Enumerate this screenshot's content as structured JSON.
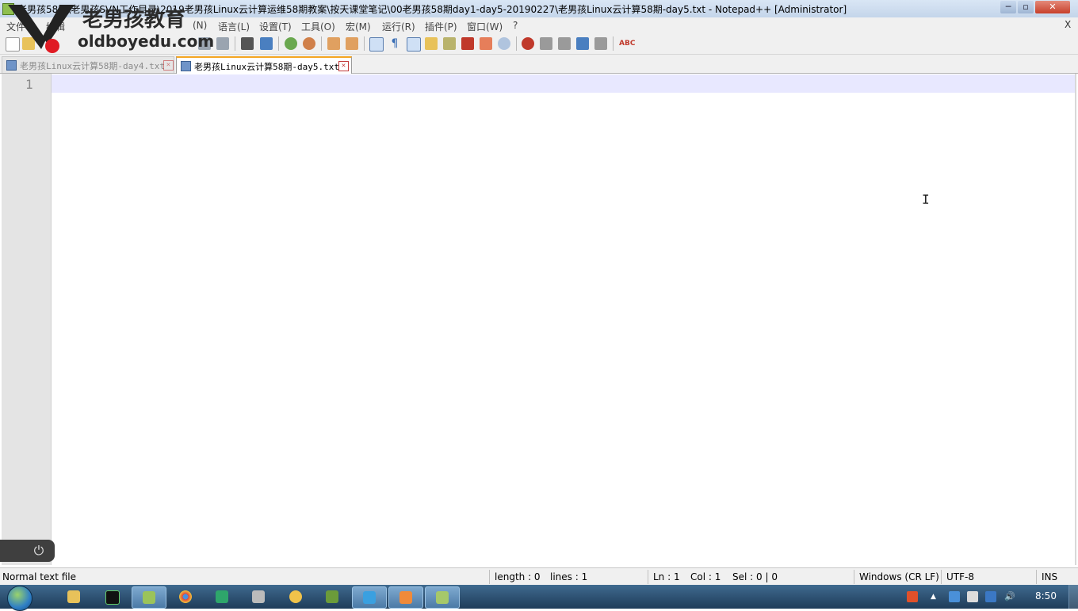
{
  "window": {
    "title": "老男孩58期\\老男孩SVN工作目录\\2019老男孩Linux云计算运维58期教案\\按天课堂笔记\\00老男孩58期day1-day5-20190227\\老男孩Linux云计算58期-day5.txt - Notepad++ [Administrator]",
    "title_short": "老男孩58期\\老男孩SVN工作目录\\2019老男孩Linux云计算运维58期教案\\按天课堂笔记\\00老男孩58期day1-day5-20190227\\老男孩Linux云计算58期-day5.txt - Notepad++ [Administrator]",
    "minimize": "─",
    "maximize": "▫",
    "close": "✕"
  },
  "menu": {
    "items": [
      "文件",
      "编辑",
      "(N)",
      "语言(L)",
      "设置(T)",
      "工具(O)",
      "宏(M)",
      "运行(R)",
      "插件(P)",
      "窗口(W)",
      "?"
    ],
    "close_doc": "X"
  },
  "tabs": [
    {
      "label": "老男孩Linux云计算58期-day4.txt",
      "active": false
    },
    {
      "label": "老男孩Linux云计算58期-day5.txt",
      "active": true
    }
  ],
  "editor": {
    "line_number": "1",
    "content": "",
    "cursor_glyph": "I"
  },
  "watermark": {
    "top": "老男孩教育",
    "bottom": "oldboyedu.com"
  },
  "statusbar": {
    "file_type": "Normal text file",
    "length": "length : 0",
    "lines": "lines : 1",
    "ln": "Ln : 1",
    "col": "Col : 1",
    "sel": "Sel : 0 | 0",
    "eol": "Windows (CR LF)",
    "encoding": "UTF-8",
    "mode": "INS"
  },
  "taskbar": {
    "time": "8:50"
  },
  "colors": {
    "current_line": "#e8e8ff",
    "active_tab_accent": "#f5a623",
    "taskbar": "#2b4d6e"
  }
}
